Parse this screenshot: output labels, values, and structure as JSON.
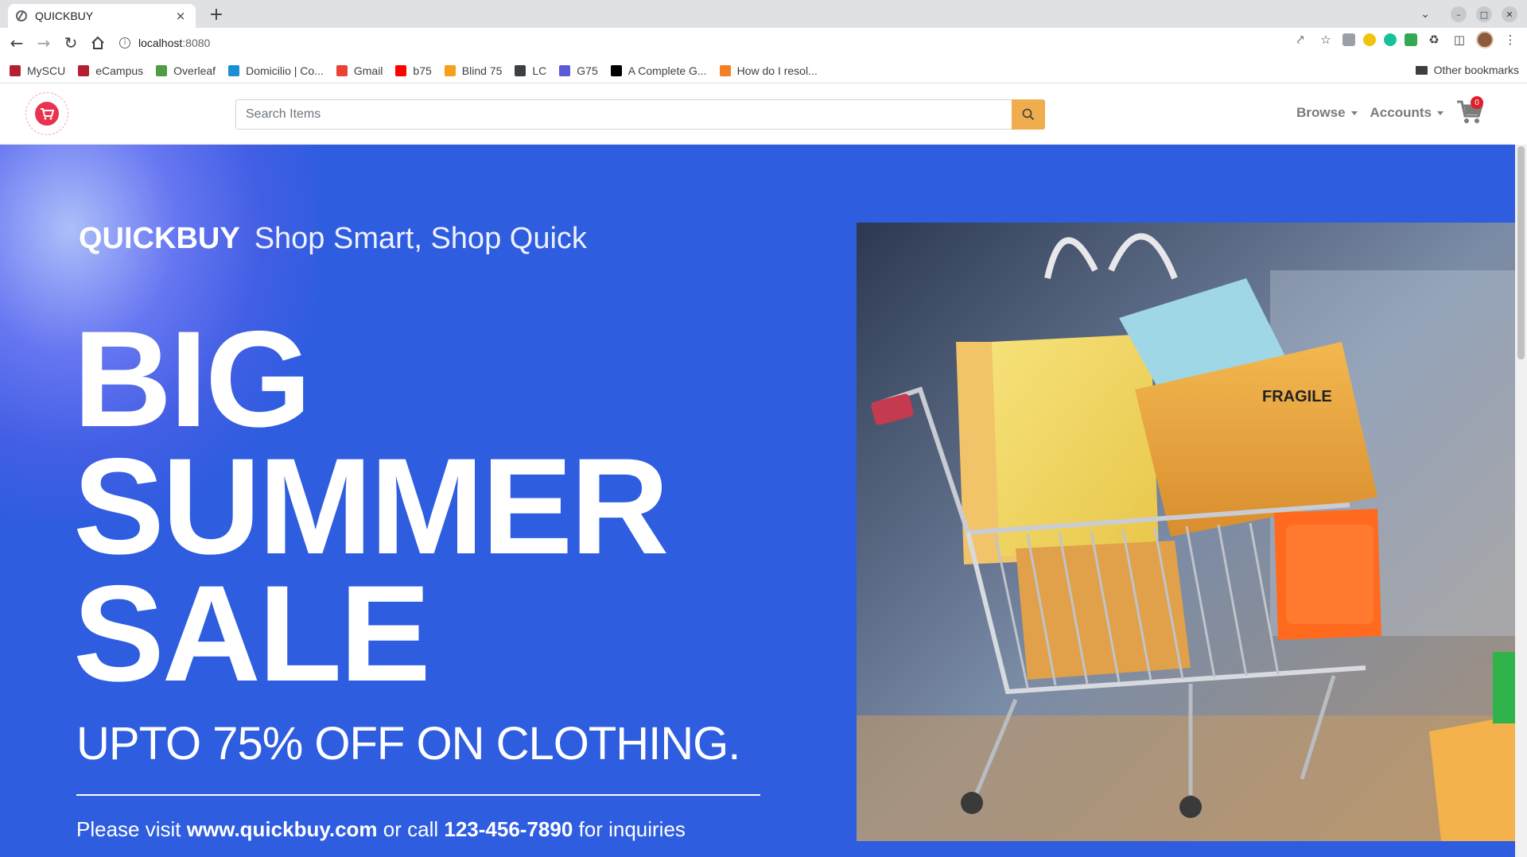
{
  "browser": {
    "tab_title": "QUICKBUY",
    "tab_close": "×",
    "new_tab": "+",
    "url_host": "localhost",
    "url_port": ":8080",
    "bookmarks": [
      {
        "label": "MySCU",
        "icon": "scu-icon",
        "color": "#b3202f"
      },
      {
        "label": "eCampus",
        "icon": "scu-icon",
        "color": "#b3202f"
      },
      {
        "label": "Overleaf",
        "icon": "overleaf-icon",
        "color": "#4f9c45"
      },
      {
        "label": "Domicilio | Co...",
        "icon": "domicilio-icon",
        "color": "#1a8fd6"
      },
      {
        "label": "Gmail",
        "icon": "gmail-icon",
        "color": "#ea4335"
      },
      {
        "label": "b75",
        "icon": "youtube-icon",
        "color": "#ff0000"
      },
      {
        "label": "Blind 75",
        "icon": "leetcode-icon",
        "color": "#f89f1b"
      },
      {
        "label": "LC",
        "icon": "leetcode-icon",
        "color": "#3c4043"
      },
      {
        "label": "G75",
        "icon": "g75-icon",
        "color": "#5b5bd6"
      },
      {
        "label": "A Complete G...",
        "icon": "dev-icon",
        "color": "#000000"
      },
      {
        "label": "How do I resol...",
        "icon": "stackoverflow-icon",
        "color": "#f48024"
      }
    ],
    "other_bookmarks": "Other bookmarks"
  },
  "header": {
    "search_placeholder": "Search Items",
    "nav": {
      "browse": "Browse",
      "accounts": "Accounts"
    },
    "cart_count": "0"
  },
  "hero": {
    "brand": "QUICKBUY",
    "tagline": "Shop Smart, Shop Quick",
    "headline_lines": [
      "BIG",
      "SUMMER",
      "SALE"
    ],
    "offer": "UPTO 75% OFF ON CLOTHING.",
    "contact_prefix": "Please visit ",
    "website": "www.quickbuy.com",
    "contact_middle": " or call ",
    "phone": "123-456-7890",
    "contact_suffix": " for inquiries"
  },
  "colors": {
    "hero_bg": "#2e5de0",
    "search_button": "#f0ad4e",
    "brand_red": "#e8324f",
    "cart_badge": "#e11d2a"
  }
}
